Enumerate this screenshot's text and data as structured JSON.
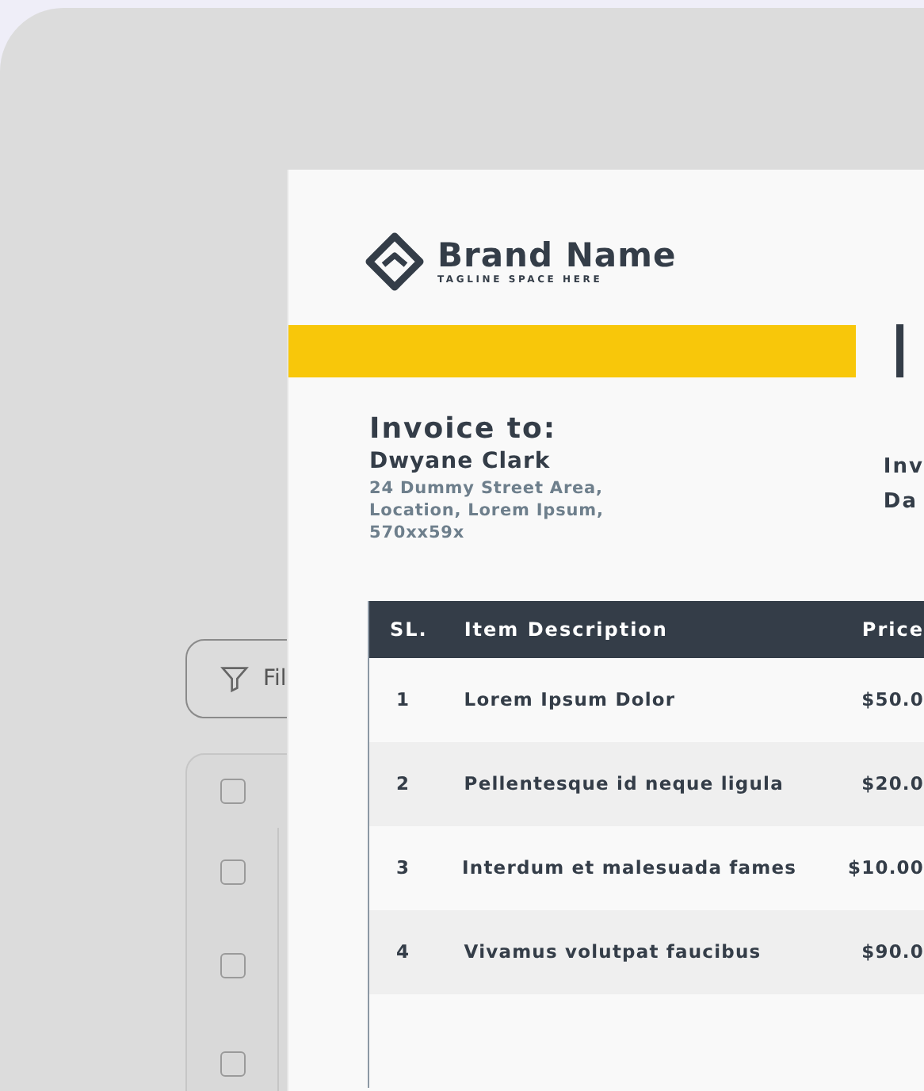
{
  "background_app": {
    "filter_button": {
      "label": "Fil"
    },
    "table_rows": [
      {
        "checked": false
      },
      {
        "checked": false
      },
      {
        "checked": false
      },
      {
        "checked": false
      }
    ]
  },
  "invoice": {
    "brand": {
      "name": "Brand Name",
      "tagline": "TAGLINE SPACE HERE"
    },
    "title": "I",
    "bill_to": {
      "heading": "Invoice to:",
      "name": "Dwyane Clark",
      "address": [
        "24 Dummy Street Area,",
        "Location, Lorem Ipsum,",
        "570xx59x"
      ]
    },
    "meta": [
      "Inv",
      "Da"
    ],
    "table": {
      "columns": [
        "SL.",
        "Item Description",
        "Price"
      ],
      "rows": [
        {
          "sl": "1",
          "description": "Lorem Ipsum Dolor",
          "price": "$50.0"
        },
        {
          "sl": "2",
          "description": "Pellentesque id neque ligula",
          "price": "$20.0"
        },
        {
          "sl": "3",
          "description": "Interdum et malesuada fames",
          "price": "$10.00"
        },
        {
          "sl": "4",
          "description": "Vivamus volutpat faucibus",
          "price": "$90.0"
        }
      ]
    }
  }
}
